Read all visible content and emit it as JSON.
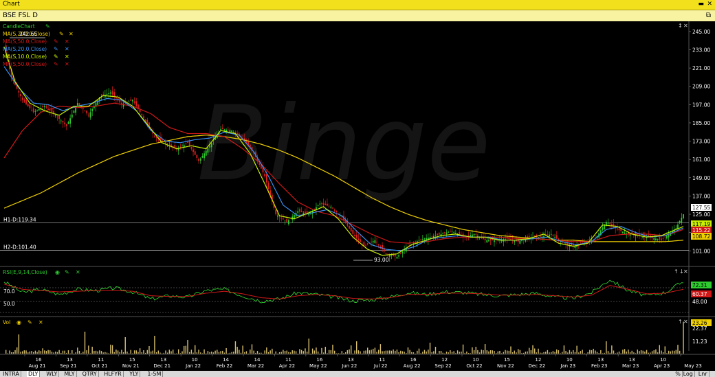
{
  "window": {
    "title": "Chart",
    "symbol_title": "BSE FSL D",
    "watermark": "Binge"
  },
  "colors": {
    "title_bar": "#f2e01c",
    "price_up": "#2ecc2e",
    "price_down": "#e02020",
    "ma200": "#f0d000",
    "ma50": "#d01818",
    "ma20": "#3a8ef0",
    "ma10": "#c8f000",
    "rsi": "#2ecc2e",
    "rsi_signal": "#d01818",
    "volume": "#d8c070"
  },
  "legend": {
    "candle": "CandleChart",
    "ma200": "MA(S,200.0,Close)",
    "ma50": "MA(S,50.0,Close)",
    "ma20": "MA(S,20.0,Close)",
    "ma10": "MA(S,10.0,Close)",
    "ma50b": "MA(S,50.0,Close)",
    "rsi": "RSI(E,9,14,Close)",
    "vol": "Vol"
  },
  "horizontal_lines": {
    "h1_label": "H1-D:119.34",
    "h1_value": 119.34,
    "h2_label": "H2-D:101.40",
    "h2_value": 101.4
  },
  "annotations": {
    "high_label": "242.65",
    "low_label": "93.00"
  },
  "price_tags": {
    "last": "127.55",
    "ma10": "117.19",
    "ma20": "115.22",
    "ma200": "108.72"
  },
  "rsi_tags": {
    "rsi": "72.31",
    "signal": "60.37",
    "level_70": "70.0",
    "level_50": "50.0",
    "axis_48": "48.00"
  },
  "vol_tags": {
    "last": "23.26",
    "axis_22": "22.37",
    "axis_11": "11.23"
  },
  "bottom_tabs": [
    "INTRA",
    "DLY",
    "WLY",
    "MLY",
    "QTRY",
    "HLFYR",
    "YLY",
    "1-5M"
  ],
  "active_tab": "DLY",
  "bottom_right": [
    "%",
    "Log",
    "Lnr"
  ],
  "chart_data": {
    "type": "line",
    "title": "BSE FSL D",
    "y_axis_ticks": [
      "245.00",
      "233.00",
      "221.00",
      "209.00",
      "197.00",
      "185.00",
      "173.00",
      "161.00",
      "149.00",
      "137.00",
      "125.00",
      "113.00",
      "101.00"
    ],
    "ylim": [
      93,
      249
    ],
    "x_ticks": [
      {
        "day": "16",
        "month": "Aug 21"
      },
      {
        "day": "13",
        "month": "Sep 21"
      },
      {
        "day": "11",
        "month": "Oct 21"
      },
      {
        "day": "15",
        "month": "Nov 21"
      },
      {
        "day": "13",
        "month": "Dec 21"
      },
      {
        "day": "10",
        "month": "Jan 22"
      },
      {
        "day": "14",
        "month": "Feb 22"
      },
      {
        "day": "14",
        "month": "Mar 22"
      },
      {
        "day": "11",
        "month": "Apr 22"
      },
      {
        "day": "16",
        "month": "May 22"
      },
      {
        "day": "13",
        "month": "Jun 22"
      },
      {
        "day": "11",
        "month": "Jul 22"
      },
      {
        "day": "16",
        "month": "Aug 22"
      },
      {
        "day": "12",
        "month": "Sep 22"
      },
      {
        "day": "10",
        "month": "Oct 22"
      },
      {
        "day": "15",
        "month": "Nov 22"
      },
      {
        "day": "12",
        "month": "Dec 22"
      },
      {
        "day": "10",
        "month": "Jan 23"
      },
      {
        "day": "13",
        "month": "Feb 23"
      },
      {
        "day": "13",
        "month": "Mar 23"
      },
      {
        "day": "10",
        "month": "Apr 23"
      },
      {
        "day": "",
        "month": "May 23"
      }
    ],
    "close_keypoints": [
      [
        0,
        236
      ],
      [
        4,
        215
      ],
      [
        10,
        200
      ],
      [
        16,
        192
      ],
      [
        22,
        196
      ],
      [
        28,
        190
      ],
      [
        34,
        183
      ],
      [
        40,
        198
      ],
      [
        46,
        190
      ],
      [
        52,
        202
      ],
      [
        58,
        205
      ],
      [
        64,
        197
      ],
      [
        70,
        200
      ],
      [
        76,
        188
      ],
      [
        82,
        176
      ],
      [
        88,
        171
      ],
      [
        94,
        168
      ],
      [
        100,
        172
      ],
      [
        106,
        160
      ],
      [
        112,
        170
      ],
      [
        118,
        181
      ],
      [
        124,
        180
      ],
      [
        130,
        175
      ],
      [
        136,
        165
      ],
      [
        142,
        150
      ],
      [
        148,
        125
      ],
      [
        154,
        120
      ],
      [
        160,
        127
      ],
      [
        166,
        125
      ],
      [
        172,
        132
      ],
      [
        178,
        130
      ],
      [
        184,
        123
      ],
      [
        190,
        112
      ],
      [
        196,
        104
      ],
      [
        202,
        108
      ],
      [
        208,
        99
      ],
      [
        214,
        97
      ],
      [
        220,
        104
      ],
      [
        226,
        108
      ],
      [
        232,
        110
      ],
      [
        238,
        112
      ],
      [
        244,
        114
      ],
      [
        250,
        110
      ],
      [
        256,
        112
      ],
      [
        262,
        108
      ],
      [
        268,
        108
      ],
      [
        274,
        109
      ],
      [
        280,
        107
      ],
      [
        286,
        110
      ],
      [
        292,
        110
      ],
      [
        298,
        112
      ],
      [
        304,
        106
      ],
      [
        310,
        104
      ],
      [
        316,
        106
      ],
      [
        322,
        109
      ],
      [
        328,
        120
      ],
      [
        334,
        115
      ],
      [
        340,
        112
      ],
      [
        346,
        111
      ],
      [
        352,
        110
      ],
      [
        358,
        108
      ],
      [
        362,
        112
      ],
      [
        366,
        116
      ],
      [
        370,
        125
      ]
    ],
    "ma200_keypoints": [
      [
        0,
        129
      ],
      [
        20,
        139
      ],
      [
        40,
        152
      ],
      [
        60,
        163
      ],
      [
        80,
        171
      ],
      [
        100,
        176
      ],
      [
        110,
        177
      ],
      [
        120,
        176
      ],
      [
        130,
        174
      ],
      [
        140,
        171
      ],
      [
        150,
        167
      ],
      [
        160,
        162
      ],
      [
        170,
        156
      ],
      [
        180,
        150
      ],
      [
        190,
        143
      ],
      [
        200,
        136
      ],
      [
        210,
        130
      ],
      [
        220,
        125
      ],
      [
        230,
        121
      ],
      [
        240,
        118
      ],
      [
        250,
        115
      ],
      [
        260,
        113
      ],
      [
        270,
        111
      ],
      [
        280,
        110
      ],
      [
        290,
        109
      ],
      [
        300,
        108
      ],
      [
        310,
        108
      ],
      [
        320,
        107
      ],
      [
        330,
        107
      ],
      [
        340,
        107
      ],
      [
        350,
        107
      ],
      [
        360,
        107
      ],
      [
        370,
        108
      ]
    ],
    "ma50_keypoints": [
      [
        0,
        162
      ],
      [
        10,
        180
      ],
      [
        20,
        192
      ],
      [
        30,
        196
      ],
      [
        40,
        195
      ],
      [
        50,
        196
      ],
      [
        60,
        198
      ],
      [
        70,
        196
      ],
      [
        80,
        191
      ],
      [
        90,
        182
      ],
      [
        100,
        178
      ],
      [
        110,
        178
      ],
      [
        120,
        176
      ],
      [
        130,
        168
      ],
      [
        140,
        158
      ],
      [
        150,
        145
      ],
      [
        160,
        133
      ],
      [
        170,
        127
      ],
      [
        180,
        124
      ],
      [
        190,
        118
      ],
      [
        200,
        112
      ],
      [
        210,
        107
      ],
      [
        220,
        106
      ],
      [
        230,
        107
      ],
      [
        240,
        109
      ],
      [
        250,
        110
      ],
      [
        260,
        110
      ],
      [
        270,
        110
      ],
      [
        280,
        109
      ],
      [
        290,
        109
      ],
      [
        300,
        108
      ],
      [
        310,
        107
      ],
      [
        320,
        107
      ],
      [
        330,
        111
      ],
      [
        340,
        112
      ],
      [
        350,
        112
      ],
      [
        360,
        111
      ],
      [
        370,
        115
      ]
    ],
    "ma20_keypoints": [
      [
        0,
        222
      ],
      [
        8,
        208
      ],
      [
        16,
        198
      ],
      [
        24,
        197
      ],
      [
        32,
        193
      ],
      [
        40,
        196
      ],
      [
        48,
        198
      ],
      [
        56,
        201
      ],
      [
        64,
        200
      ],
      [
        72,
        193
      ],
      [
        80,
        180
      ],
      [
        88,
        173
      ],
      [
        96,
        172
      ],
      [
        104,
        174
      ],
      [
        112,
        175
      ],
      [
        120,
        179
      ],
      [
        128,
        177
      ],
      [
        136,
        166
      ],
      [
        144,
        150
      ],
      [
        152,
        131
      ],
      [
        160,
        124
      ],
      [
        168,
        126
      ],
      [
        176,
        128
      ],
      [
        184,
        124
      ],
      [
        192,
        114
      ],
      [
        200,
        105
      ],
      [
        208,
        102
      ],
      [
        216,
        101
      ],
      [
        224,
        104
      ],
      [
        232,
        109
      ],
      [
        240,
        110
      ],
      [
        248,
        111
      ],
      [
        256,
        110
      ],
      [
        264,
        110
      ],
      [
        272,
        108
      ],
      [
        280,
        108
      ],
      [
        288,
        109
      ],
      [
        296,
        110
      ],
      [
        304,
        107
      ],
      [
        312,
        105
      ],
      [
        320,
        107
      ],
      [
        328,
        115
      ],
      [
        336,
        117
      ],
      [
        344,
        113
      ],
      [
        352,
        110
      ],
      [
        360,
        111
      ],
      [
        370,
        116
      ]
    ],
    "ma10_keypoints": [
      [
        0,
        235
      ],
      [
        6,
        212
      ],
      [
        14,
        198
      ],
      [
        22,
        193
      ],
      [
        30,
        190
      ],
      [
        38,
        196
      ],
      [
        46,
        196
      ],
      [
        54,
        203
      ],
      [
        62,
        202
      ],
      [
        70,
        196
      ],
      [
        78,
        184
      ],
      [
        86,
        172
      ],
      [
        94,
        168
      ],
      [
        102,
        170
      ],
      [
        110,
        168
      ],
      [
        118,
        180
      ],
      [
        126,
        178
      ],
      [
        134,
        165
      ],
      [
        142,
        145
      ],
      [
        150,
        124
      ],
      [
        158,
        122
      ],
      [
        166,
        126
      ],
      [
        174,
        130
      ],
      [
        182,
        122
      ],
      [
        190,
        110
      ],
      [
        198,
        102
      ],
      [
        206,
        98
      ],
      [
        214,
        99
      ],
      [
        222,
        105
      ],
      [
        230,
        108
      ],
      [
        238,
        111
      ],
      [
        246,
        112
      ],
      [
        254,
        110
      ],
      [
        262,
        110
      ],
      [
        270,
        108
      ],
      [
        278,
        108
      ],
      [
        286,
        109
      ],
      [
        294,
        112
      ],
      [
        302,
        106
      ],
      [
        310,
        104
      ],
      [
        318,
        106
      ],
      [
        326,
        118
      ],
      [
        334,
        117
      ],
      [
        342,
        112
      ],
      [
        350,
        110
      ],
      [
        358,
        111
      ],
      [
        366,
        115
      ],
      [
        370,
        117
      ]
    ],
    "rsi_keypoints": [
      [
        0,
        72
      ],
      [
        10,
        55
      ],
      [
        20,
        60
      ],
      [
        30,
        52
      ],
      [
        40,
        60
      ],
      [
        50,
        58
      ],
      [
        60,
        62
      ],
      [
        70,
        56
      ],
      [
        80,
        45
      ],
      [
        90,
        50
      ],
      [
        100,
        48
      ],
      [
        110,
        58
      ],
      [
        120,
        60
      ],
      [
        130,
        50
      ],
      [
        140,
        42
      ],
      [
        150,
        45
      ],
      [
        160,
        55
      ],
      [
        170,
        52
      ],
      [
        180,
        48
      ],
      [
        190,
        42
      ],
      [
        200,
        44
      ],
      [
        210,
        48
      ],
      [
        220,
        55
      ],
      [
        230,
        52
      ],
      [
        240,
        56
      ],
      [
        250,
        55
      ],
      [
        260,
        52
      ],
      [
        270,
        50
      ],
      [
        280,
        52
      ],
      [
        290,
        54
      ],
      [
        300,
        48
      ],
      [
        310,
        46
      ],
      [
        320,
        55
      ],
      [
        330,
        75
      ],
      [
        340,
        58
      ],
      [
        350,
        50
      ],
      [
        360,
        55
      ],
      [
        370,
        72
      ]
    ],
    "rsi_signal_keypoints": [
      [
        0,
        68
      ],
      [
        10,
        60
      ],
      [
        20,
        58
      ],
      [
        30,
        56
      ],
      [
        40,
        57
      ],
      [
        50,
        58
      ],
      [
        60,
        58
      ],
      [
        70,
        57
      ],
      [
        80,
        50
      ],
      [
        90,
        49
      ],
      [
        100,
        49
      ],
      [
        110,
        54
      ],
      [
        120,
        57
      ],
      [
        130,
        53
      ],
      [
        140,
        47
      ],
      [
        150,
        45
      ],
      [
        160,
        50
      ],
      [
        170,
        52
      ],
      [
        180,
        50
      ],
      [
        190,
        46
      ],
      [
        200,
        45
      ],
      [
        210,
        47
      ],
      [
        220,
        52
      ],
      [
        230,
        52
      ],
      [
        240,
        54
      ],
      [
        250,
        54
      ],
      [
        260,
        53
      ],
      [
        270,
        51
      ],
      [
        280,
        51
      ],
      [
        290,
        52
      ],
      [
        300,
        50
      ],
      [
        310,
        48
      ],
      [
        320,
        51
      ],
      [
        330,
        66
      ],
      [
        340,
        60
      ],
      [
        350,
        53
      ],
      [
        360,
        54
      ],
      [
        370,
        60
      ]
    ],
    "volume_spikes": [
      [
        8,
        14
      ],
      [
        44,
        16
      ],
      [
        66,
        12
      ],
      [
        82,
        13
      ],
      [
        100,
        10
      ],
      [
        126,
        9
      ],
      [
        166,
        11
      ],
      [
        192,
        9
      ],
      [
        232,
        8
      ],
      [
        262,
        7
      ],
      [
        328,
        9
      ],
      [
        370,
        23.26
      ]
    ]
  }
}
